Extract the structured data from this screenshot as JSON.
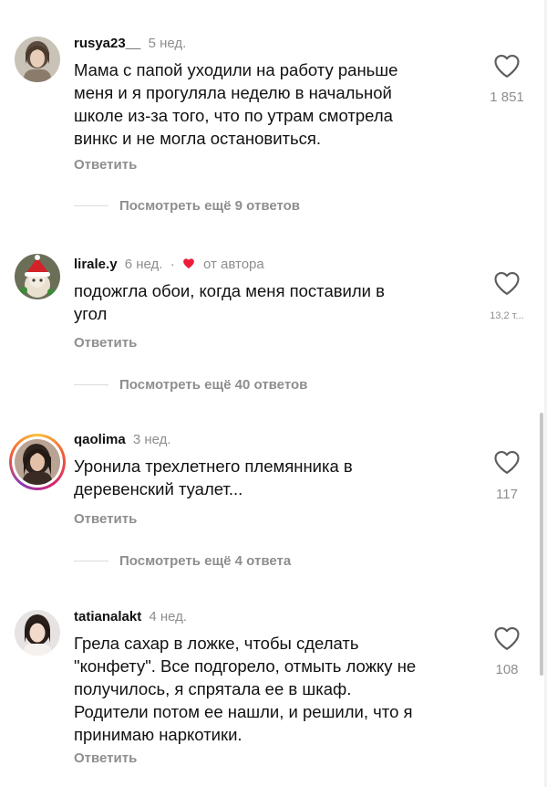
{
  "comments": [
    {
      "username": "rusya23__",
      "time": "5 нед.",
      "text_lines": [
        "Мама с папой уходили на работу раньше",
        "меня и я прогуляла неделю в начальной",
        "школе из-за того, что по утрам смотрела",
        "винкс и не могла остановиться."
      ],
      "likes": "1 851",
      "reply_label": "Ответить",
      "view_replies": "Посмотреть ещё 9 ответов"
    },
    {
      "username": "lirale.y",
      "time": "6 нед.",
      "separator": "·",
      "author_liked": "от автора",
      "text_lines": [
        "подожгла обои, когда меня поставили в",
        "угол"
      ],
      "likes": "13,2 т...",
      "reply_label": "Ответить",
      "view_replies": "Посмотреть ещё 40 ответов"
    },
    {
      "username": "qaolima",
      "time": "3 нед.",
      "text_lines": [
        "Уронила трехлетнего племянника в",
        "деревенский туалет..."
      ],
      "likes": "117",
      "reply_label": "Ответить",
      "view_replies": "Посмотреть ещё 4 ответа"
    },
    {
      "username": "tatianalakt",
      "time": "4 нед.",
      "text_lines": [
        "Грела сахар в ложке, чтобы сделать",
        "\"конфету\". Все подгорело, отмыть ложку не",
        "получилось, я спрятала ее в шкаф.",
        "Родители потом ее нашли, и решили, что я",
        "принимаю наркотики."
      ],
      "likes": "108",
      "reply_label": "Ответить"
    }
  ],
  "icons": {
    "like": "heart-outline-icon",
    "author_like": "red-heart-icon"
  },
  "colors": {
    "text": "#111111",
    "secondary": "#8e8e8e",
    "author_heart": "#ed1c3a",
    "story_ring": "#d6246b"
  }
}
